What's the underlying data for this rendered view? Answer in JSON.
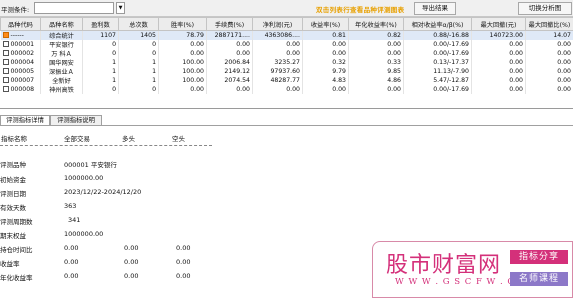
{
  "toolbar": {
    "filter_label": "平测条件:",
    "filter_value": "",
    "title": "双击列表行查看品种评测图表",
    "export_label": "导出结果",
    "switch_label": "切换分析图"
  },
  "table": {
    "headers": [
      "品种代码",
      "品种名称",
      "盈利数",
      "总次数",
      "胜率(%)",
      "手续费(%)",
      "净利润(元)",
      "收益率(%)",
      "年化收益率(%)",
      "相对收益率α/β(%)",
      "最大回撤(元)",
      "最大回撤比(%)"
    ],
    "rows": [
      [
        "------",
        "综合统计",
        "1107",
        "1405",
        "78.79",
        "2887171....",
        "4363086....",
        "0.81",
        "0.82",
        "0.88/-16.88",
        "140723.00",
        "14.07"
      ],
      [
        "000001",
        "平安银行",
        "0",
        "0",
        "0.00",
        "0.00",
        "0.00",
        "0.00",
        "0.00",
        "0.00/-17.69",
        "0.00",
        "0.00"
      ],
      [
        "000002",
        "万 科Ａ",
        "0",
        "0",
        "0.00",
        "0.00",
        "0.00",
        "0.00",
        "0.00",
        "0.00/-17.69",
        "0.00",
        "0.00"
      ],
      [
        "000004",
        "国华网安",
        "1",
        "1",
        "100.00",
        "2006.84",
        "3235.27",
        "0.32",
        "0.33",
        "0.13/-17.37",
        "0.00",
        "0.00"
      ],
      [
        "000005",
        "深振业Ａ",
        "1",
        "1",
        "100.00",
        "2149.12",
        "97937.60",
        "9.79",
        "9.85",
        "11.13/-7.90",
        "0.00",
        "0.00"
      ],
      [
        "000007",
        "全新好",
        "1",
        "1",
        "100.00",
        "2074.54",
        "48287.77",
        "4.83",
        "4.86",
        "5.47/-12.87",
        "0.00",
        "0.00"
      ],
      [
        "000008",
        "神州高铁",
        "0",
        "0",
        "0.00",
        "0.00",
        "0.00",
        "0.00",
        "0.00",
        "0.00/-17.69",
        "0.00",
        "0.00"
      ]
    ]
  },
  "tabs": [
    "评测指标详情",
    "评测指标说明"
  ],
  "metrics": {
    "headers": [
      "指标名称",
      "全部交易",
      "多头",
      "空头"
    ],
    "rows": [
      {
        "label": "评测品种",
        "value": "000001 平安银行"
      },
      {
        "label": "初始资金",
        "value": "1000000.00"
      },
      {
        "label": "评测日期",
        "value": "2023/12/22-2024/12/20"
      },
      {
        "label": "有效天数",
        "value": "363"
      },
      {
        "label": "评测周期数",
        "value": "341"
      },
      {
        "label": "期末权益",
        "value": "1000000.00"
      },
      {
        "label": "持仓时间比",
        "value": "0.00",
        "v2": "0.00",
        "v3": "0.00"
      },
      {
        "label": "收益率",
        "value": "0.00",
        "v2": "0.00",
        "v3": "0.00"
      },
      {
        "label": "年化收益率",
        "value": "0.00",
        "v2": "0.00",
        "v3": "0.00"
      }
    ]
  },
  "watermark": {
    "site_name": "股市财富网",
    "url": "W W W . G S C F W . C O M",
    "badge_1": "指标分享",
    "badge_2": "名师课程"
  }
}
